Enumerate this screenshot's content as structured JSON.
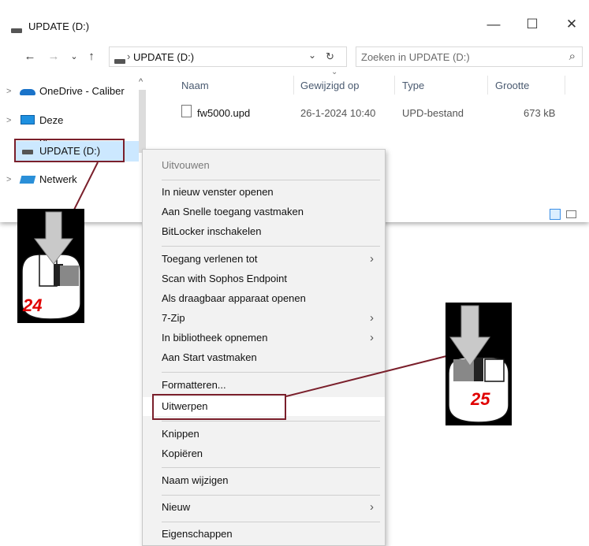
{
  "window": {
    "title": "UPDATE (D:)",
    "controls": {
      "minimize": "—",
      "maximize": "☐",
      "close": "✕"
    }
  },
  "nav": {
    "back": "←",
    "forward": "→",
    "recent": "⌄",
    "up": "↑"
  },
  "address": {
    "separator": "›",
    "path": "UPDATE (D:)",
    "dropdown": "⌄",
    "refresh": "↻"
  },
  "search": {
    "placeholder": "Zoeken in UPDATE (D:)",
    "icon": "⌕"
  },
  "tree": {
    "items": [
      {
        "label": "OneDrive - Caliber",
        "icon": "cloud-icon",
        "expander": ">"
      },
      {
        "label": "Deze pc",
        "icon": "computer-icon",
        "expander": ">"
      },
      {
        "label": "UPDATE (D:)",
        "icon": "drive-icon",
        "expander": ""
      },
      {
        "label": "Netwerk",
        "icon": "network-icon",
        "expander": ">"
      }
    ],
    "scroll_up": "^"
  },
  "columns": {
    "name": "Naam",
    "modified": "Gewijzigd op",
    "type": "Type",
    "size": "Grootte",
    "sort_indicator": "⌄"
  },
  "files": [
    {
      "name": "fw5000.upd",
      "modified": "26-1-2024 10:40",
      "type": "UPD-bestand",
      "size": "673 kB"
    }
  ],
  "context_menu": {
    "items": [
      {
        "label": "Uitvouwen",
        "submenu": false,
        "dim": true
      },
      {
        "label": "In nieuw venster openen",
        "submenu": false
      },
      {
        "label": "Aan Snelle toegang vastmaken",
        "submenu": false
      },
      {
        "label": "BitLocker inschakelen",
        "submenu": false
      },
      {
        "label": "Toegang verlenen tot",
        "submenu": true
      },
      {
        "label": "Scan with Sophos Endpoint",
        "submenu": false
      },
      {
        "label": "Als draagbaar apparaat openen",
        "submenu": false
      },
      {
        "label": "7-Zip",
        "submenu": true
      },
      {
        "label": "In bibliotheek opnemen",
        "submenu": true
      },
      {
        "label": "Aan Start vastmaken",
        "submenu": false
      },
      {
        "label": "Formatteren...",
        "submenu": false
      },
      {
        "label": "Uitwerpen",
        "submenu": false
      },
      {
        "label": "Knippen",
        "submenu": false
      },
      {
        "label": "Kopiëren",
        "submenu": false
      },
      {
        "label": "Naam wijzigen",
        "submenu": false
      },
      {
        "label": "Nieuw",
        "submenu": true
      },
      {
        "label": "Eigenschappen",
        "submenu": false
      }
    ],
    "submenu_arrow": "›"
  },
  "annotations": {
    "step1": {
      "number": "24",
      "mouse_button": "right"
    },
    "step2": {
      "number": "25",
      "mouse_button": "left"
    }
  },
  "colors": {
    "highlight_border": "#7a1f2b",
    "step_number": "#e00000",
    "selected_bg": "#cce8ff"
  }
}
